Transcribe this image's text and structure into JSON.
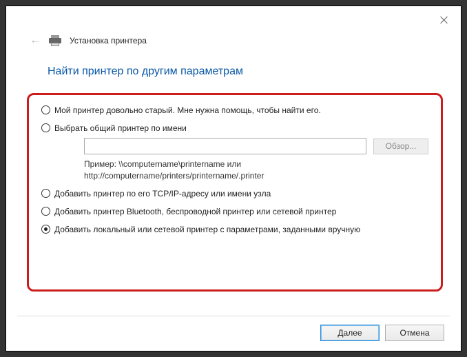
{
  "header": {
    "wizard_title": "Установка принтера"
  },
  "heading": "Найти принтер по другим параметрам",
  "options": {
    "old_printer": "Мой принтер довольно старый. Мне нужна помощь, чтобы найти его.",
    "shared_by_name": "Выбрать общий принтер по имени",
    "browse_label": "Обзор...",
    "example_line1": "Пример: \\\\computername\\printername или",
    "example_line2": "http://computername/printers/printername/.printer",
    "tcp_ip": "Добавить принтер по его TCP/IP-адресу или имени узла",
    "bluetooth": "Добавить принтер Bluetooth, беспроводной принтер или сетевой принтер",
    "manual": "Добавить локальный или сетевой принтер с параметрами, заданными вручную"
  },
  "footer": {
    "next": "Далее",
    "cancel": "Отмена"
  }
}
